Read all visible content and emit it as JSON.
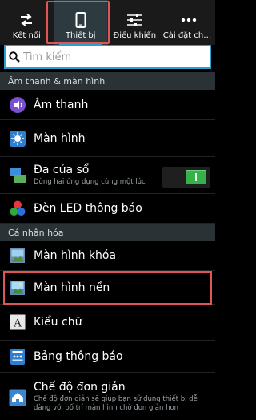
{
  "tabs": [
    {
      "label": "Kết nối",
      "icon": "swap-arrows-icon"
    },
    {
      "label": "Thiết bị",
      "icon": "phone-icon"
    },
    {
      "label": "Điều khiển",
      "icon": "sliders-icon"
    },
    {
      "label": "Cài đặt chu...",
      "icon": "more-dots-icon"
    }
  ],
  "search": {
    "placeholder": "Tìm kiếm"
  },
  "sections": [
    {
      "label": "Âm thanh & màn hình"
    },
    {
      "label": "Cá nhân hóa"
    }
  ],
  "items": [
    {
      "title": "Âm thanh",
      "icon": "volume-icon"
    },
    {
      "title": "Màn hình",
      "icon": "brightness-icon"
    },
    {
      "title": "Đa cửa sổ",
      "subtitle": "Dùng hai ứng dụng cùng một lúc",
      "icon": "multi-window-icon",
      "toggle": "on"
    },
    {
      "title": "Đèn LED thông báo",
      "icon": "led-icon"
    },
    {
      "title": "Màn hình khóa",
      "icon": "lock-screen-icon"
    },
    {
      "title": "Màn hình nền",
      "icon": "wallpaper-icon"
    },
    {
      "title": "Kiểu chữ",
      "icon": "font-icon"
    },
    {
      "title": "Bảng thông báo",
      "icon": "notification-panel-icon"
    },
    {
      "title": "Chế độ đơn giản",
      "subtitle": "Chế độ đơn giản sẽ giúp bạn sử dụng thiết bị dễ dàng với bố trí màn hình chờ đơn giản hơn",
      "icon": "home-icon"
    }
  ],
  "colors": {
    "accent": "#2a9fd6",
    "highlight": "#e05555",
    "toggle_on": "#36b24a"
  }
}
